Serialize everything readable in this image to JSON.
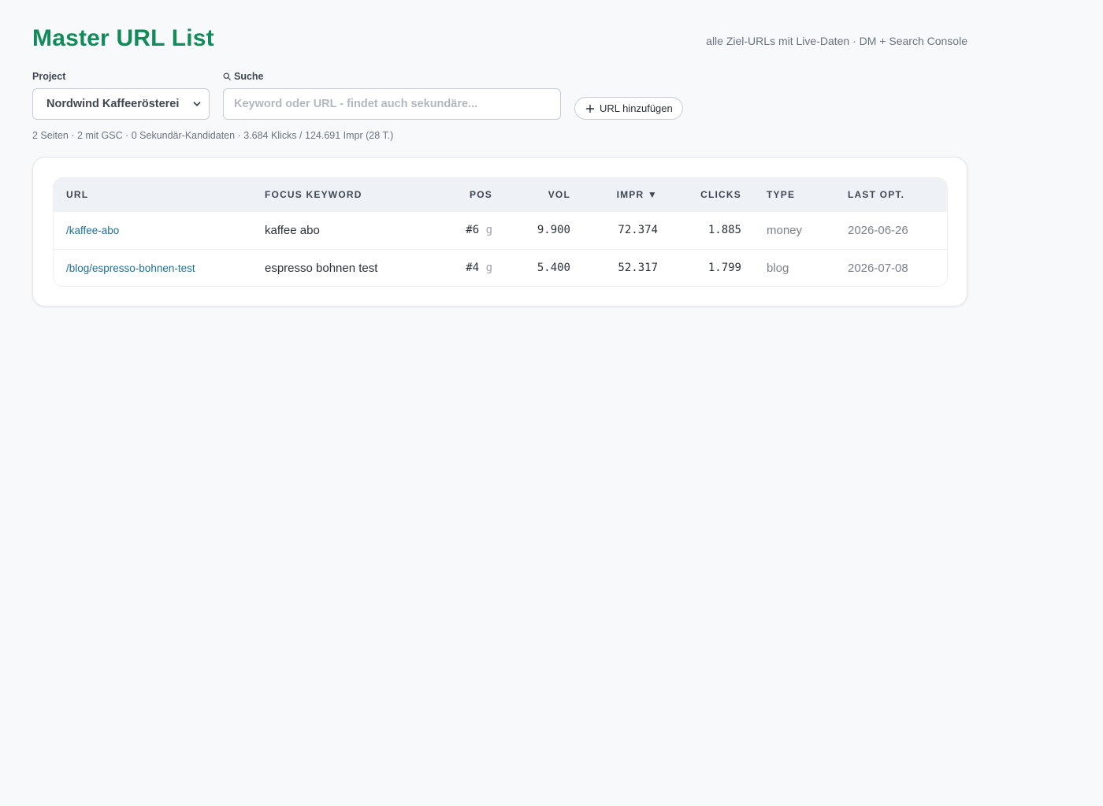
{
  "header": {
    "title": "Master URL List",
    "subtitle": "alle Ziel-URLs mit Live-Daten · DM + Search Console"
  },
  "filters": {
    "project_label": "Project",
    "project_value": "Nordwind Kaffeerösterei",
    "search_label": "Suche",
    "search_placeholder": "Keyword oder URL - findet auch sekundäre...",
    "search_value": "",
    "add_url_label": "URL hinzufügen"
  },
  "summary": "2 Seiten · 2 mit GSC · 0 Sekundär-Kandidaten · 3.684 Klicks / 124.691 Impr (28 T.)",
  "table": {
    "columns": {
      "url": "URL",
      "focus_keyword": "FOCUS KEYWORD",
      "pos": "POS",
      "vol": "VOL",
      "impr": "IMPR ▼",
      "clicks": "CLICKS",
      "type": "TYPE",
      "last_opt": "LAST OPT."
    },
    "rows": [
      {
        "url": "/kaffee-abo",
        "focus_keyword": "kaffee abo",
        "pos": "#6",
        "pos_source": "g",
        "vol": "9.900",
        "impr": "72.374",
        "clicks": "1.885",
        "type": "money",
        "last_opt": "2026-06-26"
      },
      {
        "url": "/blog/espresso-bohnen-test",
        "focus_keyword": "espresso bohnen test",
        "pos": "#4",
        "pos_source": "g",
        "vol": "5.400",
        "impr": "52.317",
        "clicks": "1.799",
        "type": "blog",
        "last_opt": "2026-07-08"
      }
    ]
  },
  "colors": {
    "accent": "#128a5a",
    "link": "#1f6f9a",
    "background": "#f8f9fb"
  },
  "icons": {
    "search": "search-icon",
    "select": "chevron-down-icon",
    "add": "plus-icon"
  }
}
